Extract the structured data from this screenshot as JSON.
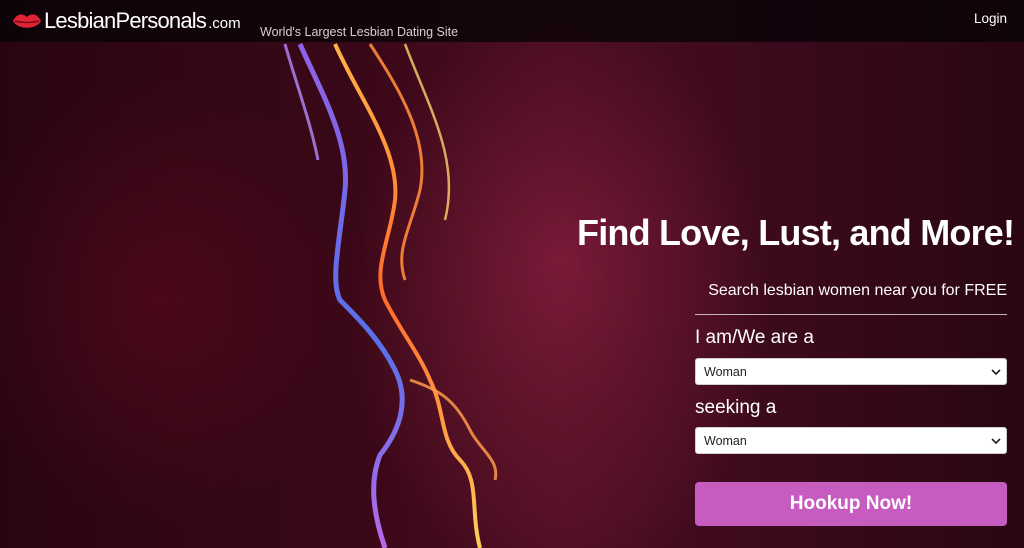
{
  "brand": {
    "name": "LesbianPersonals",
    "domain": ".com",
    "tagline": "World's Largest Lesbian Dating Site",
    "accent_color": "#c65bc0"
  },
  "header": {
    "login_label": "Login"
  },
  "hero": {
    "headline": "Find Love, Lust, and More!",
    "subheadline": "Search lesbian women near you for FREE"
  },
  "form": {
    "i_am": {
      "label": "I am/We are a",
      "selected": "Woman"
    },
    "seeking": {
      "label": "seeking a",
      "selected": "Woman"
    },
    "submit_label": "Hookup Now!"
  },
  "icons": {
    "logo": "lips-icon",
    "dropdown": "chevron-down-icon"
  }
}
